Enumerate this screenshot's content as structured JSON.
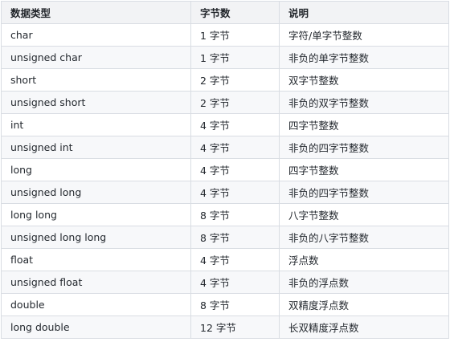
{
  "table": {
    "headers": [
      "数据类型",
      "字节数",
      "说明"
    ],
    "rows": [
      [
        "char",
        "1 字节",
        "字符/单字节整数"
      ],
      [
        "unsigned char",
        "1 字节",
        "非负的单字节整数"
      ],
      [
        "short",
        "2 字节",
        "双字节整数"
      ],
      [
        "unsigned short",
        "2 字节",
        "非负的双字节整数"
      ],
      [
        "int",
        "4 字节",
        "四字节整数"
      ],
      [
        "unsigned int",
        "4 字节",
        "非负的四字节整数"
      ],
      [
        "long",
        "4 字节",
        "四字节整数"
      ],
      [
        "unsigned long",
        "4 字节",
        "非负的四字节整数"
      ],
      [
        "long long",
        "8 字节",
        "八字节整数"
      ],
      [
        "unsigned long long",
        "8 字节",
        "非负的八字节整数"
      ],
      [
        "float",
        "4 字节",
        "浮点数"
      ],
      [
        "unsigned float",
        "4 字节",
        "非负的浮点数"
      ],
      [
        "double",
        "8 字节",
        "双精度浮点数"
      ],
      [
        "long double",
        "12 字节",
        "长双精度浮点数"
      ]
    ]
  }
}
